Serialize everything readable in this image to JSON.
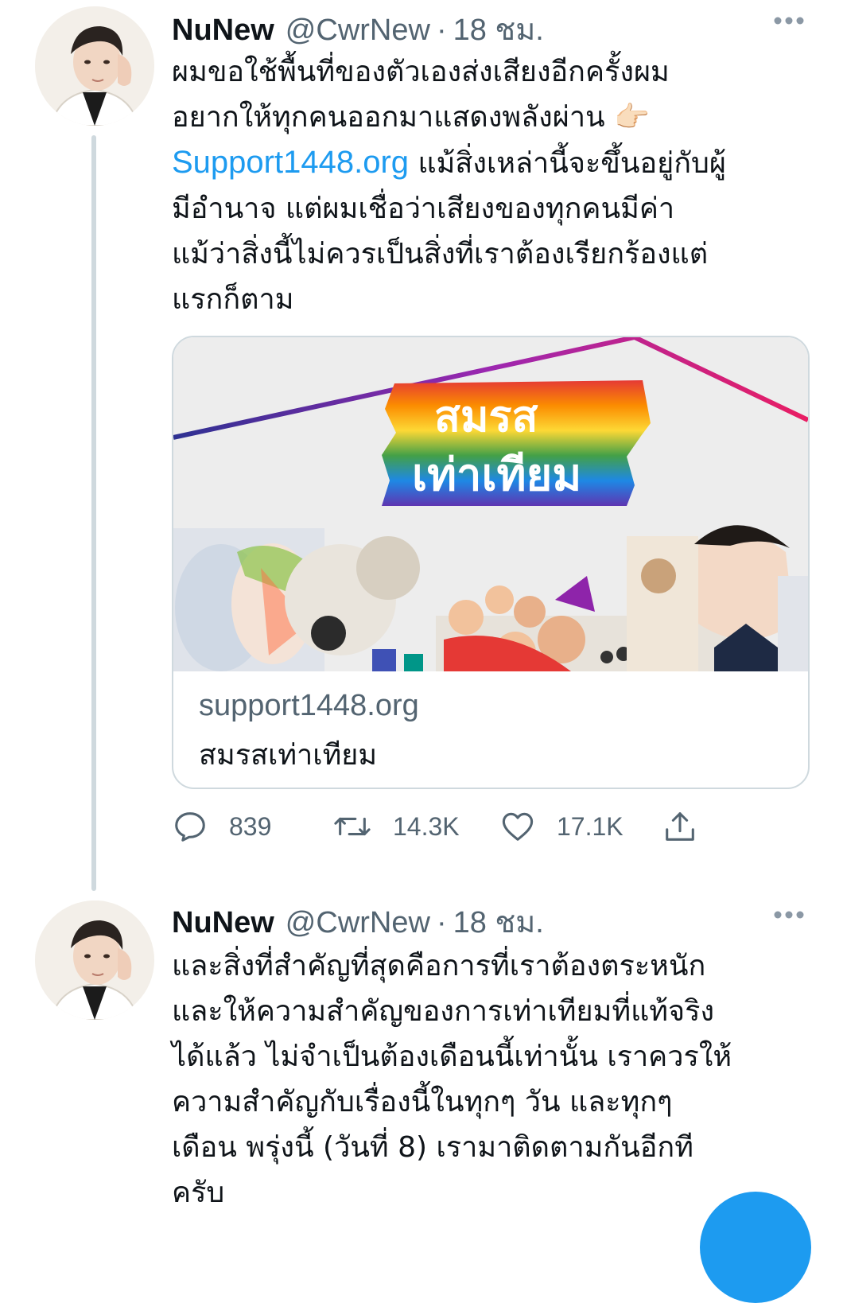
{
  "tweets": [
    {
      "display_name": "NuNew",
      "handle": "@CwrNew",
      "separator": "·",
      "time": "18 ชม.",
      "text_lines": [
        "ผมขอใช้พื้นที่ของตัวเองส่งเสียงอีกครั้งผม",
        "อยากให้ทุกคนออกมาแสดงพลังผ่าน",
        "แม้สิ่งเหล่านี้จะขึ้นอยู่กับผู้",
        "มีอำนาจ แต่ผมเชื่อว่าเสียงของทุกคนมีค่า",
        "แม้ว่าสิ่งนี้ไม่ควรเป็นสิ่งที่เราต้องเรียกร้องแต่",
        "แรกก็ตาม"
      ],
      "emoji": "👉🏻",
      "link": "Support1448.org",
      "card": {
        "image_text_top": "สมรส",
        "image_text_bottom": "เท่าเทียม",
        "domain": "support1448.org",
        "title": "สมรสเท่าเทียม"
      },
      "actions": {
        "reply_count": "839",
        "retweet_count": "14.3K",
        "like_count": "17.1K"
      }
    },
    {
      "display_name": "NuNew",
      "handle": "@CwrNew",
      "separator": "·",
      "time": "18 ชม.",
      "text_lines": [
        "และสิ่งที่สำคัญที่สุดคือการที่เราต้องตระหนัก",
        "และให้ความสำคัญของการเท่าเทียมที่แท้จริง",
        "ได้แล้ว ไม่จำเป็นต้องเดือนนี้เท่านั้น เราควรให้",
        "ความสำคัญกับเรื่องนี้ในทุกๆ วัน และทุกๆ",
        "เดือน พรุ่งนี้ (วันที่ 8) เรามาติดตามกันอีกที",
        "ครับ"
      ]
    }
  ],
  "colors": {
    "primary_text": "#0f1419",
    "secondary_text": "#536471",
    "link": "#1d9bf0",
    "border": "#cfd9de"
  },
  "icons": [
    "more-icon",
    "reply-icon",
    "retweet-icon",
    "like-icon",
    "share-icon",
    "compose-fab"
  ]
}
